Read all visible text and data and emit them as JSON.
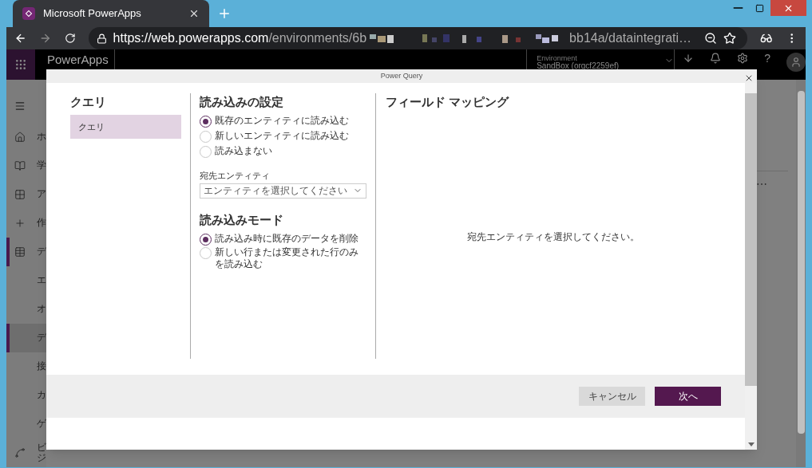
{
  "browser": {
    "tab_title": "Microsoft PowerApps",
    "url_host": "https://web.powerapps.com",
    "url_path": "/environments/6b",
    "url_tail": "bb14a/dataintegrati…"
  },
  "app_header": {
    "title": "PowerApps",
    "environment_label": "Environment",
    "environment_name": "SandBox (orgcf2259ef)",
    "help": "?"
  },
  "sidebar": {
    "items": [
      {
        "label": "ホ",
        "selected": false
      },
      {
        "label": "学",
        "selected": false
      },
      {
        "label": "ア",
        "selected": false
      },
      {
        "label": "作",
        "selected": false
      },
      {
        "label": "デ",
        "selected": false,
        "expanded": true,
        "children": [
          {
            "label": "エ",
            "selected": false
          },
          {
            "label": "オ",
            "selected": false
          },
          {
            "label": "デ",
            "selected": true
          },
          {
            "label": "接",
            "selected": false
          },
          {
            "label": "カ",
            "selected": false
          },
          {
            "label": "ゲ",
            "selected": false
          }
        ]
      },
      {
        "label": "ビジ",
        "selected": false
      }
    ]
  },
  "background": {
    "more": "⋯"
  },
  "dialog": {
    "title": "Power Query",
    "queries": {
      "heading": "クエリ",
      "items": [
        {
          "label": "クエリ",
          "selected": true
        }
      ]
    },
    "load_settings": {
      "heading": "読み込みの設定",
      "options": [
        {
          "label": "既存のエンティティに読み込む",
          "selected": true
        },
        {
          "label": "新しいエンティティに読み込む",
          "selected": false
        },
        {
          "label": "読み込まない",
          "selected": false
        }
      ],
      "destination": {
        "label": "宛先エンティティ",
        "placeholder": "エンティティを選択してください"
      }
    },
    "load_mode": {
      "heading": "読み込みモード",
      "options": [
        {
          "label": "読み込み時に既存のデータを削除",
          "selected": true
        },
        {
          "label": "新しい行または変更された行のみを読み込む",
          "selected": false
        }
      ]
    },
    "field_mapping": {
      "heading": "フィールド マッピング",
      "message": "宛先エンティティを選択してください。"
    },
    "buttons": [
      {
        "label": "キャンセル",
        "kind": "secondary"
      },
      {
        "label": "次へ",
        "kind": "primary"
      }
    ]
  }
}
